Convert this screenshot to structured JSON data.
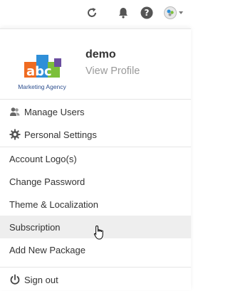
{
  "topbar": {
    "icons": [
      "refresh-icon",
      "bell-icon",
      "help-icon",
      "avatar-icon"
    ]
  },
  "profile": {
    "logo_text": "abc",
    "logo_tagline": "Marketing Agency",
    "username": "demo",
    "view_profile": "View Profile"
  },
  "menu": {
    "items": [
      {
        "label": "Manage Users",
        "icon": "users-icon"
      },
      {
        "label": "Personal Settings",
        "icon": "gear-icon"
      },
      {
        "label": "Account Logo(s)"
      },
      {
        "label": "Change Password"
      },
      {
        "label": "Theme & Localization"
      },
      {
        "label": "Subscription"
      },
      {
        "label": "Add New Package"
      }
    ],
    "sign_out": {
      "label": "Sign out",
      "icon": "power-icon"
    }
  },
  "colors": {
    "logo_a": "#ef6b21",
    "logo_b": "#2f8fd8",
    "logo_c": "#7cbf3a",
    "logo_purple": "#6b4fa0",
    "hover_bg": "#eeeeee",
    "text": "#333333",
    "muted": "#9a9a9a"
  }
}
